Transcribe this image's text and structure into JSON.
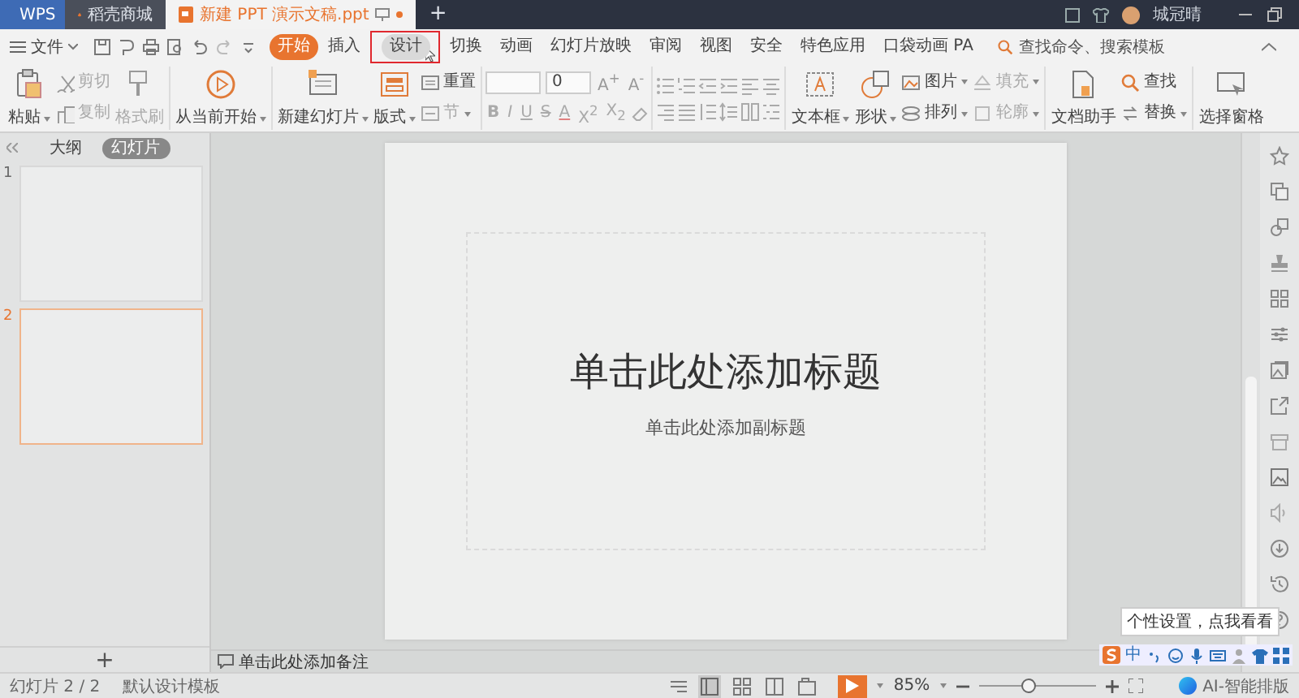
{
  "tabs": [
    {
      "label": "WPS",
      "kind": "home",
      "selected": false
    },
    {
      "label": "稻壳商城",
      "kind": "store",
      "selected": false
    },
    {
      "label": "新建 PPT 演示文稿.ppt",
      "kind": "doc",
      "selected": true
    }
  ],
  "new_tab": "+",
  "user": {
    "name": "城冠晴"
  },
  "file_menu": {
    "label": "文件"
  },
  "ribbon_tabs": [
    {
      "label": "开始",
      "selected": true,
      "annotated": false
    },
    {
      "label": "插入",
      "selected": false,
      "annotated": false
    },
    {
      "label": "设计",
      "selected": false,
      "annotated": true
    },
    {
      "label": "切换",
      "selected": false,
      "annotated": false
    },
    {
      "label": "动画",
      "selected": false,
      "annotated": false
    },
    {
      "label": "幻灯片放映",
      "selected": false,
      "annotated": false
    },
    {
      "label": "审阅",
      "selected": false,
      "annotated": false
    },
    {
      "label": "视图",
      "selected": false,
      "annotated": false
    },
    {
      "label": "安全",
      "selected": false,
      "annotated": false
    },
    {
      "label": "特色应用",
      "selected": false,
      "annotated": false
    },
    {
      "label": "口袋动画 PA",
      "selected": false,
      "annotated": false
    }
  ],
  "search": {
    "placeholder": "查找命令、搜索模板"
  },
  "ribbon": [
    {
      "items": [
        {
          "kind": "large",
          "label": "粘贴",
          "dropdown": true,
          "disabled": false
        },
        {
          "kind": "stack",
          "items": [
            {
              "label": "剪切",
              "dropdown": false,
              "disabled": true
            },
            {
              "label": "复制",
              "dropdown": false,
              "disabled": true
            }
          ]
        },
        {
          "kind": "large",
          "label": "格式刷",
          "dropdown": false,
          "disabled": true
        }
      ]
    },
    {
      "items": [
        {
          "kind": "large",
          "label": "从当前开始",
          "dropdown": true,
          "disabled": false
        }
      ]
    },
    {
      "items": [
        {
          "kind": "large",
          "label": "新建幻灯片",
          "dropdown": true,
          "disabled": false
        },
        {
          "kind": "large",
          "label": "版式",
          "dropdown": true,
          "disabled": false
        },
        {
          "kind": "stack",
          "items": [
            {
              "label": "重置",
              "dropdown": false,
              "disabled": false
            },
            {
              "label": "节",
              "dropdown": true,
              "disabled": true
            }
          ]
        }
      ]
    },
    {
      "items": [
        {
          "kind": "font"
        }
      ]
    },
    {
      "items": [
        {
          "kind": "paragraph"
        }
      ]
    },
    {
      "items": [
        {
          "kind": "large",
          "label": "文本框",
          "dropdown": true,
          "disabled": false
        },
        {
          "kind": "large",
          "label": "形状",
          "dropdown": true,
          "disabled": false
        },
        {
          "kind": "stack",
          "items": [
            {
              "label": "图片",
              "dropdown": true,
              "disabled": false
            },
            {
              "label": "排列",
              "dropdown": true,
              "disabled": false
            }
          ]
        },
        {
          "kind": "stack",
          "items": [
            {
              "label": "填充",
              "dropdown": true,
              "disabled": true
            },
            {
              "label": "轮廓",
              "dropdown": true,
              "disabled": true
            }
          ]
        }
      ]
    },
    {
      "items": [
        {
          "kind": "large",
          "label": "文档助手",
          "dropdown": false,
          "disabled": false
        },
        {
          "kind": "stack",
          "items": [
            {
              "label": "查找",
              "dropdown": false,
              "disabled": false
            },
            {
              "label": "替换",
              "dropdown": true,
              "disabled": false
            }
          ]
        }
      ]
    },
    {
      "items": [
        {
          "kind": "large",
          "label": "选择窗格",
          "dropdown": false,
          "disabled": false
        }
      ]
    }
  ],
  "font": {
    "size": "0",
    "grow": "A$^{+}$",
    "shrink": "A$^{-}$",
    "styles": [
      {
        "label": "B",
        "disabled": true
      },
      {
        "label": "I",
        "disabled": true
      },
      {
        "label": "U",
        "disabled": true
      },
      {
        "label": "S",
        "disabled": true
      },
      {
        "label": "A",
        "disabled": true
      },
      {
        "label": "X$^{2}$",
        "disabled": true
      },
      {
        "label": "X$_{2}$",
        "disabled": true
      }
    ]
  },
  "panel": {
    "tabs": [
      {
        "label": "大纲",
        "selected": false
      },
      {
        "label": "幻灯片",
        "selected": true
      }
    ],
    "slides": [
      {
        "number": "1",
        "selected": false
      },
      {
        "number": "2",
        "selected": true
      }
    ],
    "add": "+"
  },
  "slide": {
    "title": "单击此处添加标题",
    "subtitle": "单击此处添加副标题"
  },
  "notes": {
    "placeholder": "单击此处添加备注"
  },
  "tooltip": "个性设置，点我看看",
  "ime": {
    "mode": "中"
  },
  "status": {
    "slide_count": "幻灯片 2 / 2",
    "template": "默认设计模板",
    "views": [
      {
        "selected": true
      },
      {
        "selected": false
      },
      {
        "selected": false
      },
      {
        "selected": false
      }
    ],
    "zoom": "85%",
    "zoom_slider": {
      "level": 0.42
    },
    "ai": "AI-智能排版"
  }
}
